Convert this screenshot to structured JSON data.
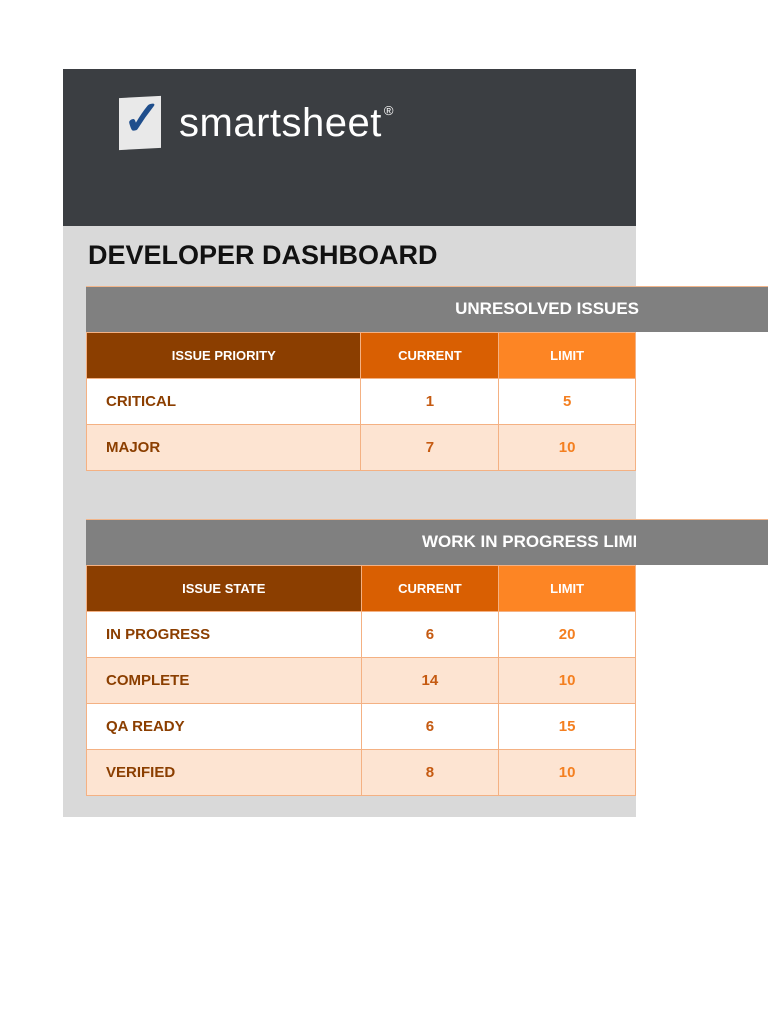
{
  "logo": {
    "text": "smartsheet",
    "mark": "®"
  },
  "title": "DEVELOPER DASHBOARD",
  "unresolved": {
    "title": "UNRESOLVED ISSUES",
    "headers": [
      "ISSUE PRIORITY",
      "CURRENT",
      "LIMIT"
    ],
    "rows": [
      [
        "CRITICAL",
        "1",
        "5"
      ],
      [
        "MAJOR",
        "7",
        "10"
      ]
    ]
  },
  "wip": {
    "title": "WORK IN PROGRESS LIMITS",
    "headers": [
      "ISSUE STATE",
      "CURRENT",
      "LIMIT"
    ],
    "rows": [
      [
        "IN PROGRESS",
        "6",
        "20"
      ],
      [
        "COMPLETE",
        "14",
        "10"
      ],
      [
        "QA READY",
        "6",
        "15"
      ],
      [
        "VERIFIED",
        "8",
        "10"
      ]
    ]
  }
}
